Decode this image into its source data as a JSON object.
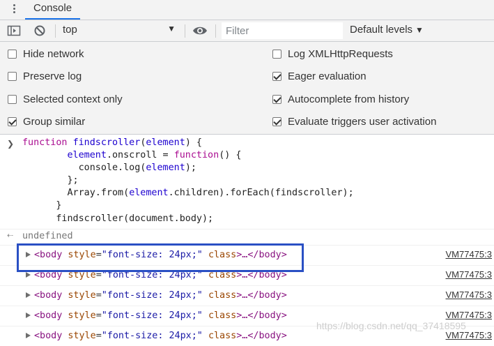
{
  "tabs": {
    "active": "Console"
  },
  "toolbar": {
    "context_value": "top",
    "filter_placeholder": "Filter",
    "levels_label": "Default levels"
  },
  "settings": {
    "left": [
      {
        "label": "Hide network",
        "checked": false
      },
      {
        "label": "Preserve log",
        "checked": false
      },
      {
        "label": "Selected context only",
        "checked": false
      },
      {
        "label": "Group similar",
        "checked": true
      }
    ],
    "right": [
      {
        "label": "Log XMLHttpRequests",
        "checked": false
      },
      {
        "label": "Eager evaluation",
        "checked": true
      },
      {
        "label": "Autocomplete from history",
        "checked": true
      },
      {
        "label": "Evaluate triggers user activation",
        "checked": true
      }
    ]
  },
  "console": {
    "input_code": [
      "function findscroller(element) {",
      "        element.onscroll = function() {",
      "          console.log(element);",
      "        };",
      "        Array.from(element.children).forEach(findscroller);",
      "      }",
      "      findscroller(document.body);"
    ],
    "result": "undefined",
    "logs": [
      {
        "tag_open": "<body",
        "attr_name": "style",
        "attr_value": "\"font-size: 24px;\"",
        "attr2": "class",
        "tail": ">…</body>",
        "source": "VM77475:3"
      },
      {
        "tag_open": "<body",
        "attr_name": "style",
        "attr_value": "\"font-size: 24px;\"",
        "attr2": "class",
        "tail": ">…</body>",
        "source": "VM77475:3"
      },
      {
        "tag_open": "<body",
        "attr_name": "style",
        "attr_value": "\"font-size: 24px;\"",
        "attr2": "class",
        "tail": ">…</body>",
        "source": "VM77475:3"
      },
      {
        "tag_open": "<body",
        "attr_name": "style",
        "attr_value": "\"font-size: 24px;\"",
        "attr2": "class",
        "tail": ">…</body>",
        "source": "VM77475:3"
      },
      {
        "tag_open": "<body",
        "attr_name": "style",
        "attr_value": "\"font-size: 24px;\"",
        "attr2": "class",
        "tail": ">…</body>",
        "source": "VM77475:3"
      }
    ]
  },
  "watermark": "https://blog.csdn.net/qq_37418595",
  "colors": {
    "highlight_box": "#2a50c4",
    "tab_underline": "#1a73e8"
  },
  "icons": [
    "more-vert-icon",
    "sidebar-toggle-icon",
    "clear-console-icon",
    "dropdown-caret-icon",
    "eye-icon",
    "prompt-chevron-icon",
    "result-arrow-icon",
    "expand-triangle-icon"
  ]
}
